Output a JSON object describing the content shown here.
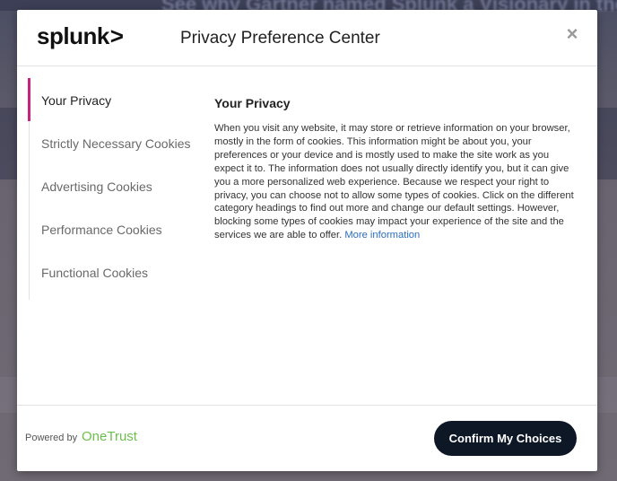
{
  "background": {
    "headline": "See why Gartner named Splunk a Visionary in the"
  },
  "modal": {
    "logo": "splunk",
    "logo_chevron": ">",
    "title": "Privacy Preference Center",
    "close_glyph": "×"
  },
  "nav": {
    "items": [
      {
        "label": "Your Privacy",
        "active": true
      },
      {
        "label": "Strictly Necessary Cookies",
        "active": false
      },
      {
        "label": "Advertising Cookies",
        "active": false
      },
      {
        "label": "Performance Cookies",
        "active": false
      },
      {
        "label": "Functional Cookies",
        "active": false
      }
    ]
  },
  "content": {
    "title": "Your Privacy",
    "body": "When you visit any website, it may store or retrieve information on your browser, mostly in the form of cookies. This information might be about you, your preferences or your device and is mostly used to make the site work as you expect it to. The information does not usually directly identify you, but it can give you a more personalized web experience. Because we respect your right to privacy, you can choose not to allow some types of cookies. Click on the different category headings to find out more and change our default settings. However, blocking some types of cookies may impact your experience of the site and the services we are able to offer.",
    "more_link": "More information"
  },
  "footer": {
    "powered_by": "Powered by",
    "brand": "OneTrust",
    "confirm_label": "Confirm My Choices"
  },
  "colors": {
    "accent": "#c5257f",
    "button_bg": "#0e1726",
    "link": "#2a6ebb",
    "brand_green": "#6cc04a"
  }
}
